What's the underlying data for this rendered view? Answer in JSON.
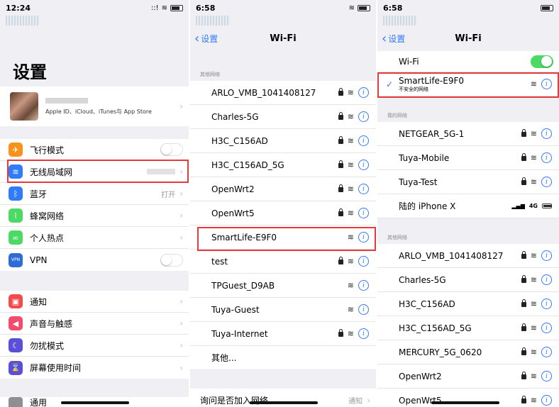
{
  "panel1": {
    "time": "12:24",
    "signal": "::!",
    "title": "设置",
    "apple_sub": "Apple ID、iCloud、iTunes与 App Store",
    "items": [
      {
        "label": "飞行模式",
        "icon": "airplane-icon",
        "color": "#f7931a",
        "glyph": "✈",
        "type": "toggle"
      },
      {
        "label": "无线局域网",
        "icon": "wifi-icon",
        "color": "#2f7cf6",
        "glyph": "≋",
        "type": "value"
      },
      {
        "label": "蓝牙",
        "icon": "bluetooth-icon",
        "color": "#2f7cf6",
        "glyph": "ᛒ",
        "type": "value",
        "value": "打开"
      },
      {
        "label": "蜂窝网络",
        "icon": "cellular-icon",
        "color": "#4cd964",
        "glyph": "⌇",
        "type": "chev"
      },
      {
        "label": "个人热点",
        "icon": "hotspot-icon",
        "color": "#4cd964",
        "glyph": "∞",
        "type": "chev"
      },
      {
        "label": "VPN",
        "icon": "vpn-icon",
        "color": "#2f6bd6",
        "glyph": "VPN",
        "type": "toggle"
      }
    ],
    "items2": [
      {
        "label": "通知",
        "icon": "notifications-icon",
        "color": "#f34b4b",
        "glyph": "▣"
      },
      {
        "label": "声音与触感",
        "icon": "sounds-icon",
        "color": "#f34b6b",
        "glyph": "◀"
      },
      {
        "label": "勿扰模式",
        "icon": "do-not-disturb-icon",
        "color": "#5a4fd6",
        "glyph": "☾"
      },
      {
        "label": "屏幕使用时间",
        "icon": "screen-time-icon",
        "color": "#5a4fd6",
        "glyph": "⌛"
      }
    ],
    "bottom_item": "通用"
  },
  "panel2": {
    "time": "6:58",
    "back_label": "设置",
    "title": "Wi-Fi",
    "section": "其他网络",
    "networks": [
      {
        "name": "ARLO_VMB_1041408127",
        "lock": true
      },
      {
        "name": "Charles-5G",
        "lock": true
      },
      {
        "name": "H3C_C156AD",
        "lock": true
      },
      {
        "name": "H3C_C156AD_5G",
        "lock": true
      },
      {
        "name": "OpenWrt2",
        "lock": true
      },
      {
        "name": "OpenWrt5",
        "lock": true
      },
      {
        "name": "SmartLife-E9F0",
        "lock": false
      },
      {
        "name": "test",
        "lock": true
      },
      {
        "name": "TPGuest_D9AB",
        "lock": false
      },
      {
        "name": "Tuya-Guest",
        "lock": false
      },
      {
        "name": "Tuya-Internet",
        "lock": true
      }
    ],
    "other_label": "其他...",
    "ask_label": "询问是否加入网络",
    "ask_value": "通知"
  },
  "panel3": {
    "time": "6:58",
    "back_label": "设置",
    "title": "Wi-Fi",
    "wifi_label": "Wi-Fi",
    "connected_name": "SmartLife-E9F0",
    "connected_sub": "不安全的网络",
    "my_section": "我的网络",
    "my_networks": [
      {
        "name": "NETGEAR_5G-1",
        "lock": true
      },
      {
        "name": "Tuya-Mobile",
        "lock": true
      },
      {
        "name": "Tuya-Test",
        "lock": true
      }
    ],
    "hotspot_name": "陆的 iPhone X",
    "hotspot_signal": "4G",
    "other_section": "其他网络",
    "other_networks": [
      {
        "name": "ARLO_VMB_1041408127",
        "lock": true
      },
      {
        "name": "Charles-5G",
        "lock": true
      },
      {
        "name": "H3C_C156AD",
        "lock": true
      },
      {
        "name": "H3C_C156AD_5G",
        "lock": true
      },
      {
        "name": "MERCURY_5G_0620",
        "lock": true
      },
      {
        "name": "OpenWrt2",
        "lock": true
      },
      {
        "name": "OpenWrt5",
        "lock": true
      }
    ]
  },
  "colors": {
    "accent": "#3478f6",
    "highlight": "#e33b3b",
    "toggle_on": "#4cd964"
  }
}
